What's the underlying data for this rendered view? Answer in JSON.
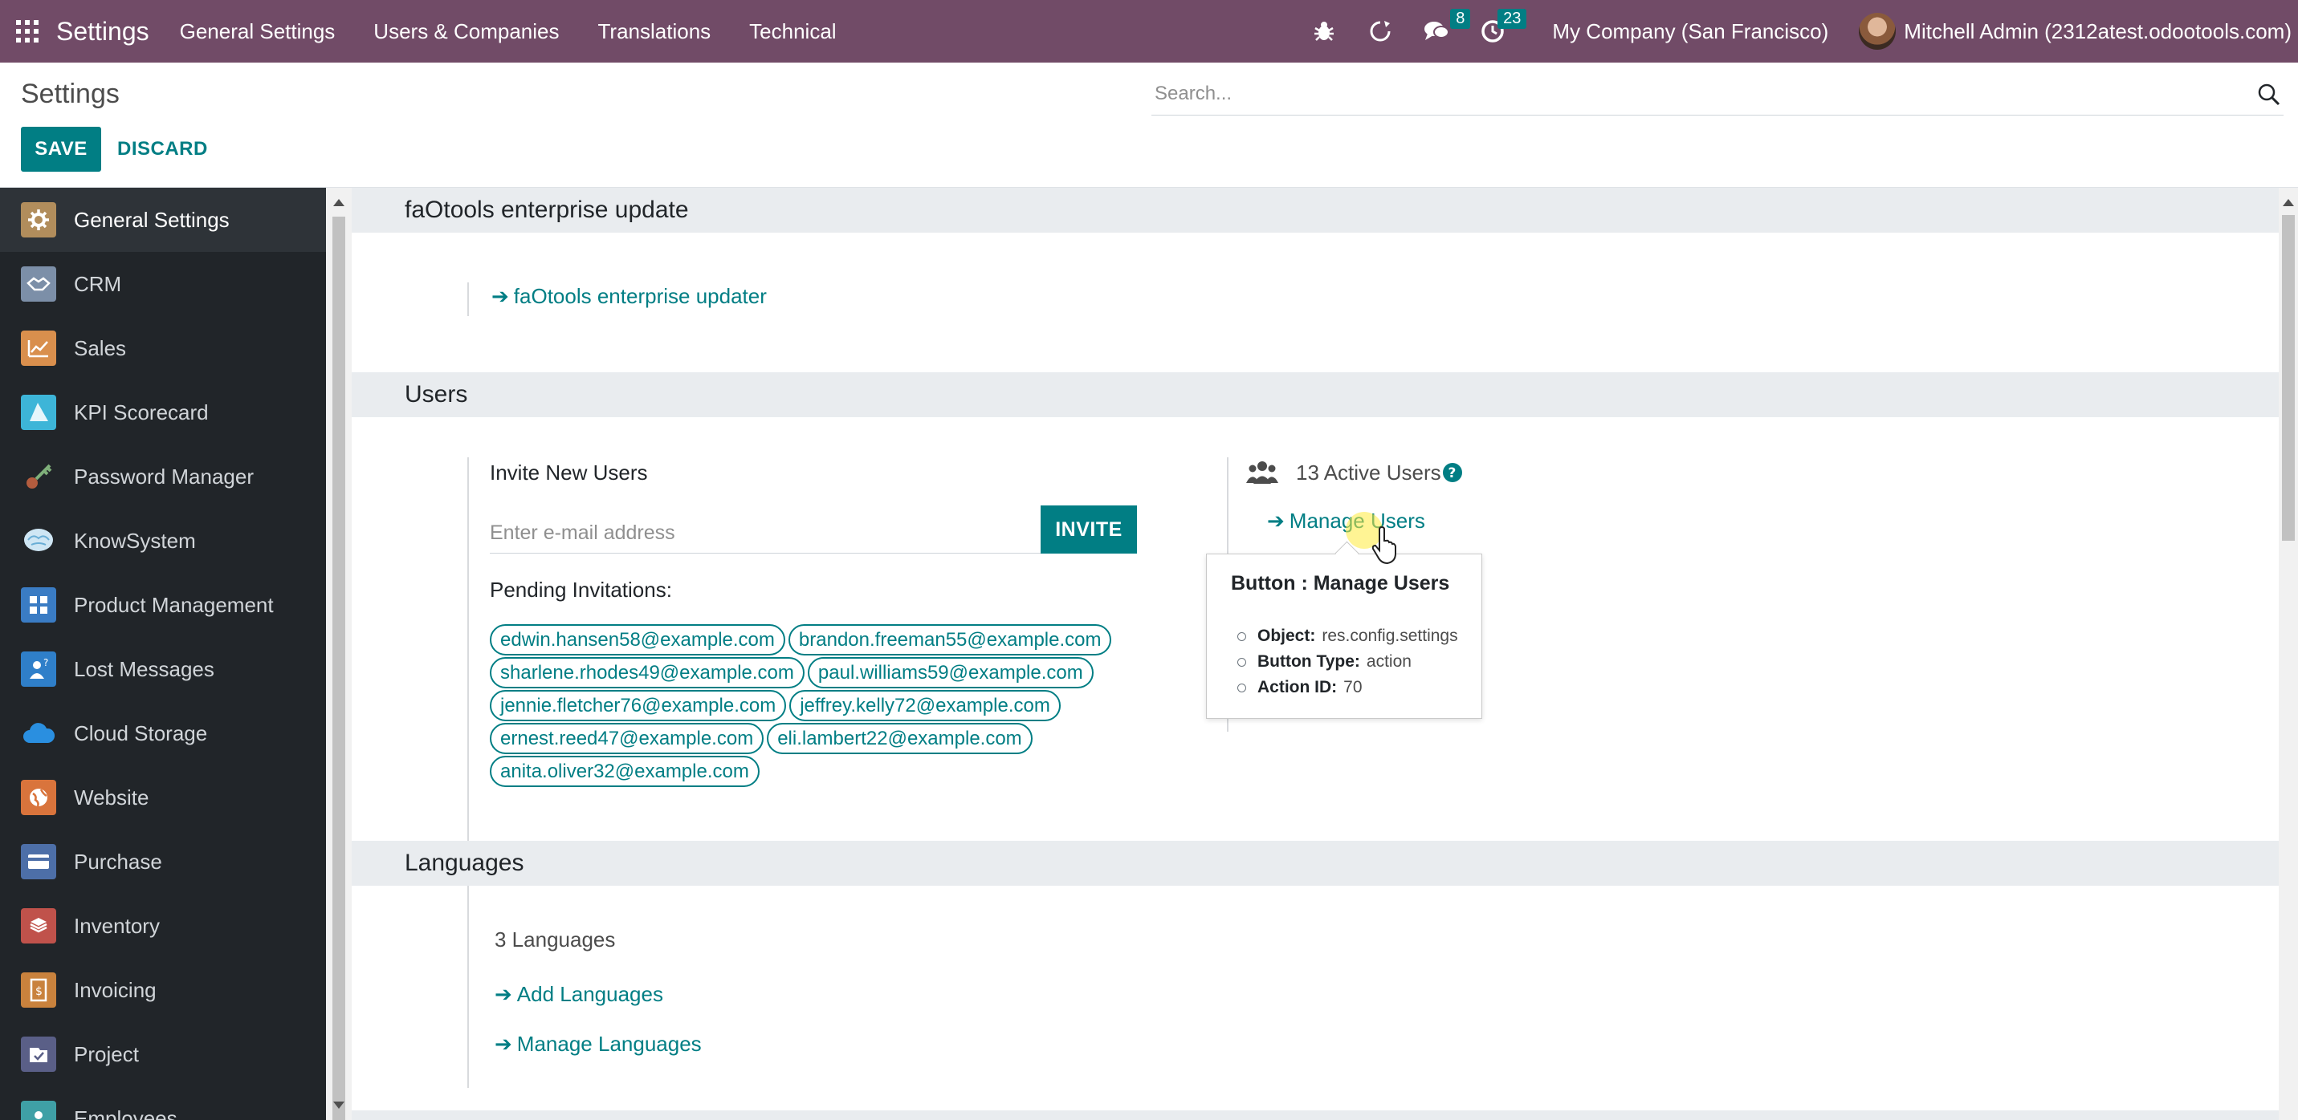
{
  "topbar": {
    "app_title": "Settings",
    "menu": [
      "General Settings",
      "Users & Companies",
      "Translations",
      "Technical"
    ],
    "icons": {
      "debug": "bug-icon",
      "activity": "refresh-icon",
      "messages": "chat-icon",
      "activities": "clock-icon"
    },
    "messages_count": "8",
    "activities_count": "23",
    "company": "My Company (San Francisco)",
    "user": "Mitchell Admin (2312atest.odootools.com)"
  },
  "control": {
    "title": "Settings",
    "save_label": "SAVE",
    "discard_label": "DISCARD",
    "search_placeholder": "Search..."
  },
  "sidebar": {
    "items": [
      {
        "label": "General Settings",
        "icon": "gear-icon",
        "color": "#b18d5c"
      },
      {
        "label": "CRM",
        "icon": "handshake-icon",
        "color": "#7c8fa8"
      },
      {
        "label": "Sales",
        "icon": "chart-line-icon",
        "color": "#d98f4d"
      },
      {
        "label": "KPI Scorecard",
        "icon": "scorecard-icon",
        "color": "#3db5d8"
      },
      {
        "label": "Password Manager",
        "icon": "key-icon",
        "color": "#b35c3e"
      },
      {
        "label": "KnowSystem",
        "icon": "brain-icon",
        "color": "#6aaed6"
      },
      {
        "label": "Product Management",
        "icon": "product-icon",
        "color": "#3a7cc4"
      },
      {
        "label": "Lost Messages",
        "icon": "person-question-icon",
        "color": "#2f7fc9"
      },
      {
        "label": "Cloud Storage",
        "icon": "cloud-icon",
        "color": "#2a8fe0"
      },
      {
        "label": "Website",
        "icon": "globe-icon",
        "color": "#d9743c"
      },
      {
        "label": "Purchase",
        "icon": "card-icon",
        "color": "#4d6fa8"
      },
      {
        "label": "Inventory",
        "icon": "box-icon",
        "color": "#c0524b"
      },
      {
        "label": "Invoicing",
        "icon": "invoice-icon",
        "color": "#c9823d"
      },
      {
        "label": "Project",
        "icon": "project-icon",
        "color": "#5a5f87"
      },
      {
        "label": "Employees",
        "icon": "employees-icon",
        "color": "#3fa0a6"
      }
    ]
  },
  "main": {
    "faotools": {
      "header": "faOtools enterprise update",
      "link": "faOtools enterprise updater"
    },
    "users": {
      "header": "Users",
      "invite_title": "Invite New Users",
      "email_placeholder": "Enter e-mail address",
      "invite_label": "INVITE",
      "pending_title": "Pending Invitations:",
      "pending": [
        "edwin.hansen58@example.com",
        "brandon.freeman55@example.com",
        "sharlene.rhodes49@example.com",
        "paul.williams59@example.com",
        "jennie.fletcher76@example.com",
        "jeffrey.kelly72@example.com",
        "ernest.reed47@example.com",
        "eli.lambert22@example.com",
        "anita.oliver32@example.com"
      ],
      "active_users": "13 Active Users",
      "manage_users": "Manage Users"
    },
    "tooltip": {
      "title": "Button : Manage Users",
      "object_label": "Object:",
      "object_value": "res.config.settings",
      "type_label": "Button Type:",
      "type_value": "action",
      "action_label": "Action ID:",
      "action_value": "70"
    },
    "languages": {
      "header": "Languages",
      "count": "3 Languages",
      "add": "Add Languages",
      "manage": "Manage Languages"
    }
  },
  "colors": {
    "navbar": "#714b67",
    "accent": "#017e84",
    "sidebar": "#212529"
  }
}
